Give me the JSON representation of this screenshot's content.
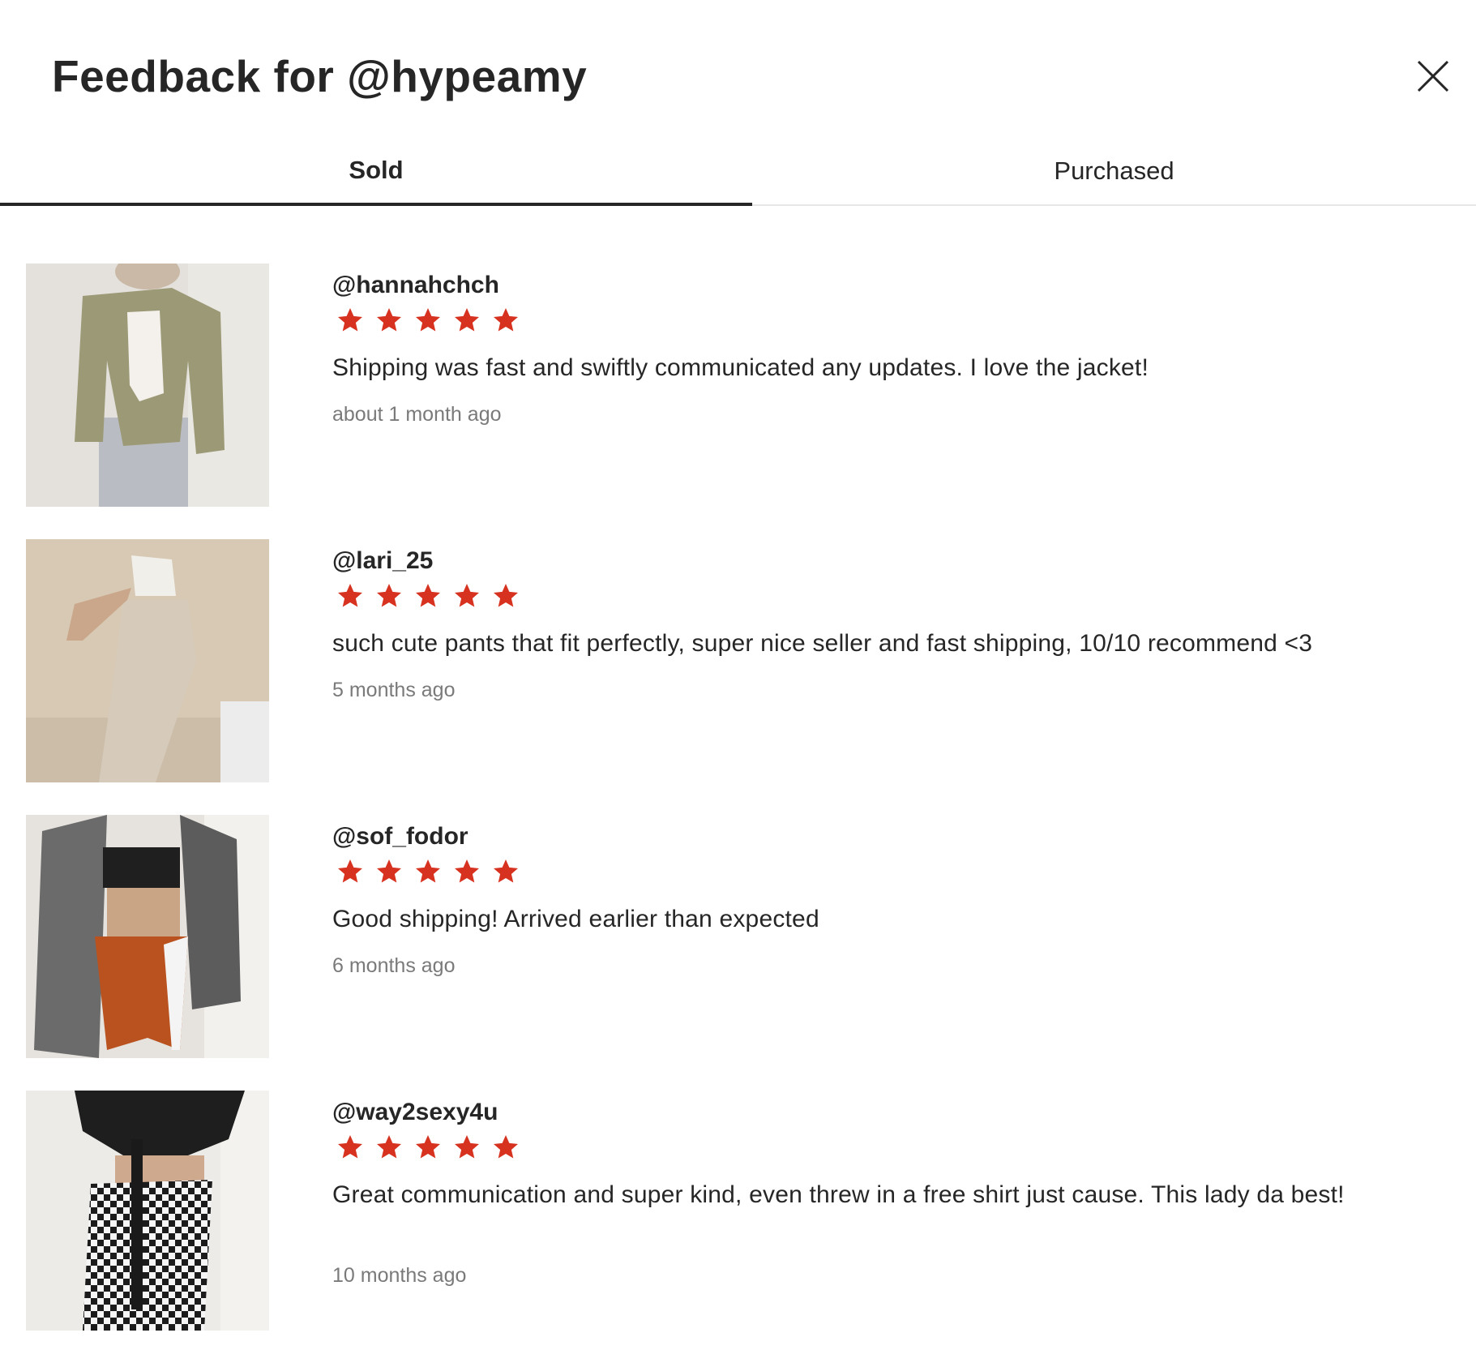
{
  "header": {
    "title": "Feedback for @hypeamy"
  },
  "tabs": [
    {
      "label": "Sold",
      "active": true
    },
    {
      "label": "Purchased",
      "active": false
    }
  ],
  "accent_colors": {
    "star": "#d6321f",
    "text": "#262626",
    "muted": "#7a7a7a"
  },
  "feedback": [
    {
      "username": "@hannahchch",
      "rating": 5,
      "comment": "Shipping was fast and swiftly communicated any updates. I love the jacket!",
      "date": "about 1 month ago"
    },
    {
      "username": "@lari_25",
      "rating": 5,
      "comment": "such cute pants that fit perfectly, super nice seller and fast shipping, 10/10 recommend <3",
      "date": "5 months ago"
    },
    {
      "username": "@sof_fodor",
      "rating": 5,
      "comment": "Good shipping! Arrived earlier than expected",
      "date": "6 months ago"
    },
    {
      "username": "@way2sexy4u",
      "rating": 5,
      "comment": "Great communication and super kind, even threw in a free shirt just cause. This lady da best!",
      "date": "10 months ago"
    }
  ]
}
